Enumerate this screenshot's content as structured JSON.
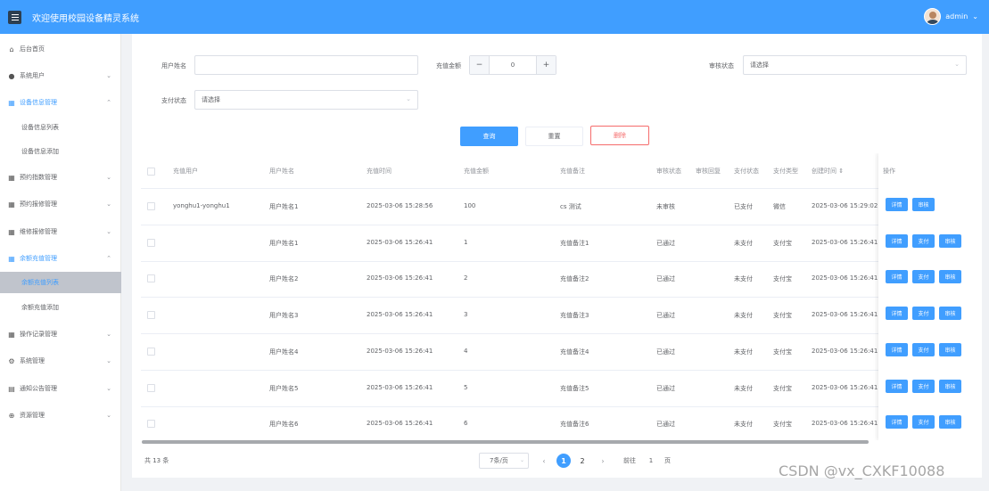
{
  "header": {
    "title": "欢迎使用校园设备精灵系统",
    "user": "admin",
    "user_caret": "⌄"
  },
  "sidebar": {
    "items": [
      {
        "label": "后台首页",
        "icon": "home-icon",
        "glyph": "⌂",
        "arrow": ""
      },
      {
        "label": "系统用户",
        "icon": "user-icon",
        "glyph": "●",
        "arrow": "⌄"
      },
      {
        "label": "设备信息管理",
        "icon": "grid-icon",
        "glyph": "▦",
        "arrow": "⌃"
      },
      {
        "label": "设备信息列表",
        "sub": true
      },
      {
        "label": "设备信息添加",
        "sub": true
      },
      {
        "label": "预约指数管理",
        "icon": "grid-icon",
        "glyph": "▦",
        "arrow": "⌄"
      },
      {
        "label": "预约报修管理",
        "icon": "grid-icon",
        "glyph": "▦",
        "arrow": "⌄"
      },
      {
        "label": "维修报修管理",
        "icon": "grid-icon",
        "glyph": "▦",
        "arrow": "⌄"
      },
      {
        "label": "余额充值管理",
        "icon": "grid-icon",
        "glyph": "▦",
        "arrow": "⌃"
      },
      {
        "label": "余额充值列表",
        "sub": true,
        "active": true
      },
      {
        "label": "余额充值添加",
        "sub": true
      },
      {
        "label": "操作记录管理",
        "icon": "grid-icon",
        "glyph": "▦",
        "arrow": "⌄"
      },
      {
        "label": "系统管理",
        "icon": "gear-icon",
        "glyph": "⚙",
        "arrow": "⌄"
      },
      {
        "label": "通知公告管理",
        "icon": "doc-icon",
        "glyph": "▤",
        "arrow": "⌄"
      },
      {
        "label": "资源管理",
        "icon": "plus-circle-icon",
        "glyph": "⊕",
        "arrow": "⌄"
      }
    ]
  },
  "filters": {
    "username_label": "用户姓名",
    "username_value": "",
    "amount_label": "充值金额",
    "amount_value": "0",
    "minus": "−",
    "plus": "+",
    "audit_label": "审核状态",
    "audit_placeholder": "请选择",
    "pay_label": "支付状态",
    "pay_placeholder": "请选择",
    "caret": "⌄"
  },
  "actions": {
    "query": "查询",
    "reset": "重置",
    "delete": "删除"
  },
  "table": {
    "columns": [
      "充值用户",
      "用户姓名",
      "充值时间",
      "充值金额",
      "充值备注",
      "审核状态",
      "审核回复",
      "支付状态",
      "支付类型",
      "创建时间 ⇕",
      "操作"
    ],
    "rows": [
      {
        "user": "yonghu1-yonghu1",
        "name": "用户姓名1",
        "time": "2025-03-06 15:28:56",
        "amount": "100",
        "remark": "cs 测试",
        "audit": "未审核",
        "reply": "",
        "pay": "已支付",
        "type": "微信",
        "created": "2025-03-06 15:29:02",
        "ops": [
          "详情",
          "审核"
        ]
      },
      {
        "user": "",
        "name": "用户姓名1",
        "time": "2025-03-06 15:26:41",
        "amount": "1",
        "remark": "充值备注1",
        "audit": "已通过",
        "reply": "",
        "pay": "未支付",
        "type": "支付宝",
        "created": "2025-03-06 15:26:41",
        "ops": [
          "详情",
          "支付",
          "审核"
        ]
      },
      {
        "user": "",
        "name": "用户姓名2",
        "time": "2025-03-06 15:26:41",
        "amount": "2",
        "remark": "充值备注2",
        "audit": "已通过",
        "reply": "",
        "pay": "未支付",
        "type": "支付宝",
        "created": "2025-03-06 15:26:41",
        "ops": [
          "详情",
          "支付",
          "审核"
        ]
      },
      {
        "user": "",
        "name": "用户姓名3",
        "time": "2025-03-06 15:26:41",
        "amount": "3",
        "remark": "充值备注3",
        "audit": "已通过",
        "reply": "",
        "pay": "未支付",
        "type": "支付宝",
        "created": "2025-03-06 15:26:41",
        "ops": [
          "详情",
          "支付",
          "审核"
        ]
      },
      {
        "user": "",
        "name": "用户姓名4",
        "time": "2025-03-06 15:26:41",
        "amount": "4",
        "remark": "充值备注4",
        "audit": "已通过",
        "reply": "",
        "pay": "未支付",
        "type": "支付宝",
        "created": "2025-03-06 15:26:41",
        "ops": [
          "详情",
          "支付",
          "审核"
        ]
      },
      {
        "user": "",
        "name": "用户姓名5",
        "time": "2025-03-06 15:26:41",
        "amount": "5",
        "remark": "充值备注5",
        "audit": "已通过",
        "reply": "",
        "pay": "未支付",
        "type": "支付宝",
        "created": "2025-03-06 15:26:41",
        "ops": [
          "详情",
          "支付",
          "审核"
        ]
      },
      {
        "user": "",
        "name": "用户姓名6",
        "time": "2025-03-06 15:26:41",
        "amount": "6",
        "remark": "充值备注6",
        "audit": "已通过",
        "reply": "",
        "pay": "未支付",
        "type": "支付宝",
        "created": "2025-03-06 15:26:41",
        "ops": [
          "详情",
          "支付",
          "审核"
        ]
      }
    ]
  },
  "pagination": {
    "total": "共 13 条",
    "page_size": "7条/页",
    "prev": "‹",
    "pages": [
      "1",
      "2"
    ],
    "current": "1",
    "next": "›",
    "goto_label": "前往",
    "goto_value": "1",
    "goto_suffix": "页"
  },
  "watermark": "CSDN @vx_CXKF10088",
  "colors": {
    "primary": "#409eff",
    "danger": "#f56c6c",
    "border": "#dcdfe6"
  }
}
